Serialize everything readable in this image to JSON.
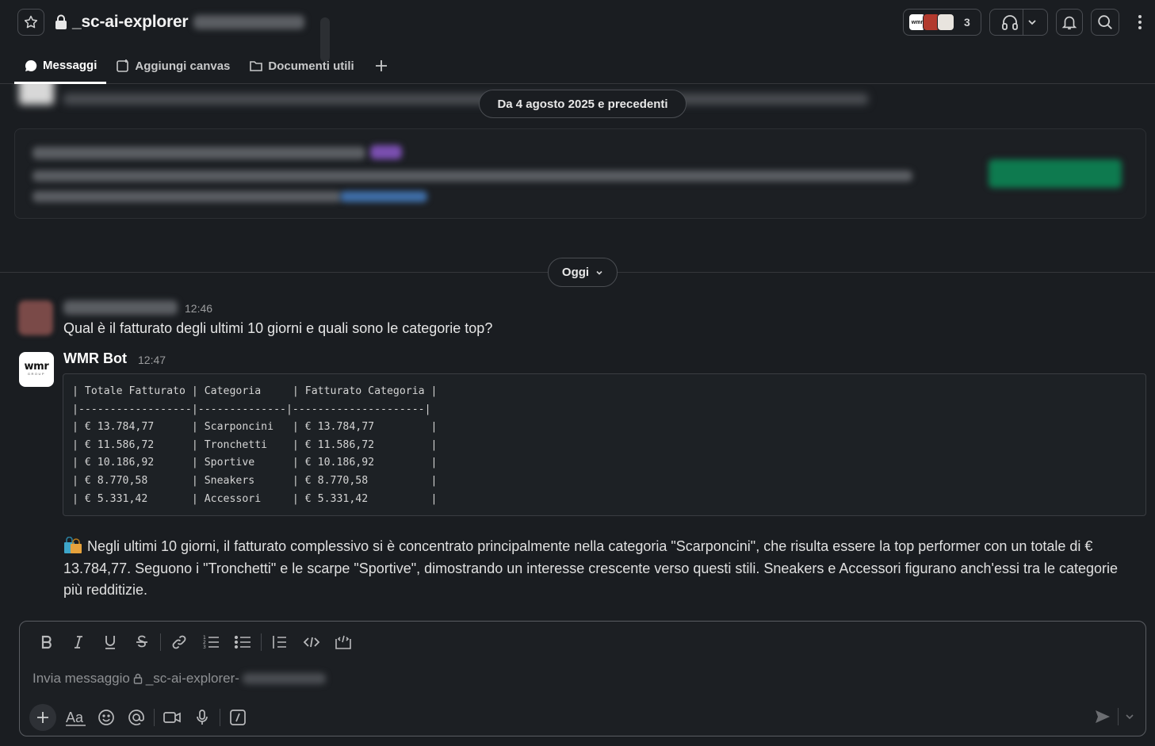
{
  "channel": {
    "name": "_sc-ai-explorer",
    "member_count": "3"
  },
  "tabs": [
    {
      "label": "Messaggi"
    },
    {
      "label": "Aggiungi canvas"
    },
    {
      "label": "Documenti utili"
    }
  ],
  "history": {
    "date_pill": "Da 4 agosto 2025 e precedenti"
  },
  "today": {
    "label": "Oggi"
  },
  "messages": [
    {
      "author": "",
      "time": "12:46",
      "text": "Qual è il fatturato degli ultimi 10 giorni e quali sono le categorie top?"
    },
    {
      "author": "WMR Bot",
      "avatar_text": "wmr",
      "avatar_subtext": "GROUP",
      "time": "12:47",
      "code": "| Totale Fatturato | Categoria     | Fatturato Categoria |\n|------------------|--------------|---------------------|\n| € 13.784,77      | Scarponcini   | € 13.784,77         |\n| € 11.586,72      | Tronchetti    | € 11.586,72         |\n| € 10.186,92      | Sportive      | € 10.186,92         |\n| € 8.770,58       | Sneakers      | € 8.770,58          |\n| € 5.331,42       | Accessori     | € 5.331,42          |",
      "summary": "Negli ultimi 10 giorni, il fatturato complessivo si è concentrato principalmente nella categoria \"Scarponcini\", che risulta essere la top performer con un totale di € 13.784,77. Seguono i \"Tronchetti\" e le scarpe \"Sportive\", dimostrando un interesse crescente verso questi stili. Sneakers e Accessori figurano anch'essi tra le categorie più redditizie."
    }
  ],
  "composer": {
    "placeholder": "Invia messaggio",
    "channel_hint": "_sc-ai-explorer-",
    "format_buttons": [
      "bold",
      "italic",
      "underline",
      "strikethrough",
      "link",
      "ordered-list",
      "bulleted-list",
      "blockquote",
      "code",
      "code-block"
    ],
    "tools": [
      "add",
      "formatting",
      "emoji",
      "mention",
      "video",
      "audio",
      "slash-command"
    ]
  },
  "colors": {
    "background": "#1a1d21",
    "border": "#4a4d52",
    "text": "#d1d2d3"
  }
}
